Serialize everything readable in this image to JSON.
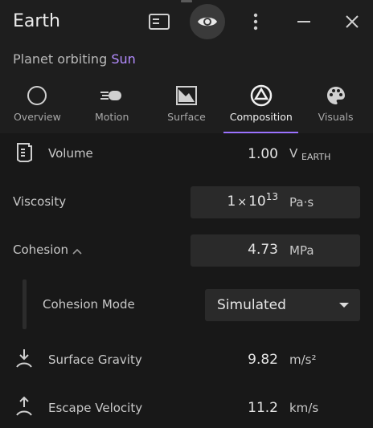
{
  "window": {
    "title": "Earth",
    "icons": {
      "panel": "panel-icon",
      "eye": "eye-icon",
      "more": "more-vertical-icon",
      "minimize": "minimize-icon",
      "close": "close-icon"
    }
  },
  "subtitle": {
    "prefix": "Planet orbiting ",
    "link": "Sun"
  },
  "tabs": [
    {
      "label": "Overview",
      "icon": "circle-icon",
      "active": false
    },
    {
      "label": "Motion",
      "icon": "motion-icon",
      "active": false
    },
    {
      "label": "Surface",
      "icon": "surface-icon",
      "active": false
    },
    {
      "label": "Composition",
      "icon": "composition-icon",
      "active": true
    },
    {
      "label": "Visuals",
      "icon": "palette-icon",
      "active": false
    }
  ],
  "properties": {
    "volume": {
      "label": "Volume",
      "value": "1.00",
      "unit_main": "V",
      "unit_sub": "EARTH"
    },
    "viscosity": {
      "label": "Viscosity",
      "mantissa": "1",
      "times": "×",
      "base": "10",
      "exponent": "13",
      "unit": "Pa·s"
    },
    "cohesion": {
      "label": "Cohesion",
      "value": "4.73",
      "unit": "MPa",
      "expanded": true
    },
    "cohesion_mode": {
      "label": "Cohesion Mode",
      "selected": "Simulated"
    },
    "surface_gravity": {
      "label": "Surface Gravity",
      "value": "9.82",
      "unit": "m/s²"
    },
    "escape_velocity": {
      "label": "Escape Velocity",
      "value": "11.2",
      "unit": "km/s"
    }
  },
  "colors": {
    "accent": "#9b72ff",
    "link": "#b48cff"
  }
}
